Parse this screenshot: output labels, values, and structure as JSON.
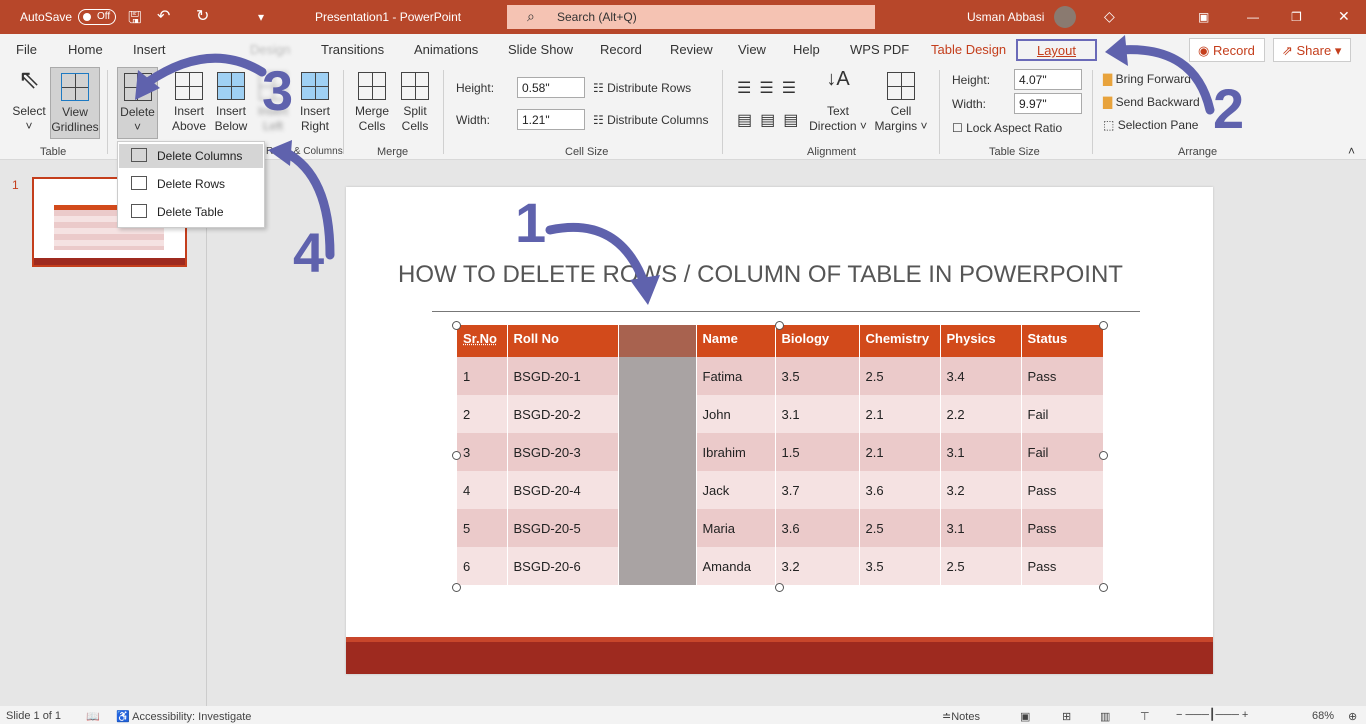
{
  "titlebar": {
    "autosave": "AutoSave",
    "autosave_state": "Off",
    "doc_title": "Presentation1  -  PowerPoint",
    "search_placeholder": "Search (Alt+Q)",
    "user": "Usman Abbasi"
  },
  "tabs": [
    "File",
    "Home",
    "Insert",
    "Design",
    "Transitions",
    "Animations",
    "Slide Show",
    "Record",
    "Review",
    "View",
    "Help",
    "WPS PDF",
    "Table Design",
    "Layout"
  ],
  "active_tab": "Layout",
  "record_btn": "Record",
  "share_btn": "Share",
  "ribbon": {
    "table_group": {
      "label": "Table",
      "select": "Select",
      "view_gridlines": "View Gridlines"
    },
    "rows_cols": {
      "delete": "Delete",
      "insert_above": "Insert Above",
      "insert_below": "Insert Below",
      "insert_left": "Insert Left",
      "insert_right": "Insert Right",
      "label": "Rows & Columns"
    },
    "merge": {
      "label": "Merge",
      "merge_cells": "Merge Cells",
      "split_cells": "Split Cells"
    },
    "cell_size": {
      "label": "Cell Size",
      "height_label": "Height:",
      "height": "0.58\"",
      "width_label": "Width:",
      "width": "1.21\"",
      "distribute_rows": "Distribute Rows",
      "distribute_columns": "Distribute Columns"
    },
    "alignment": {
      "label": "Alignment",
      "text_direction": "Text Direction",
      "cell_margins": "Cell Margins"
    },
    "table_size": {
      "label": "Table Size",
      "height_label": "Height:",
      "height": "4.07\"",
      "width_label": "Width:",
      "width": "9.97\"",
      "lock": "Lock Aspect Ratio"
    },
    "arrange": {
      "label": "Arrange",
      "bring_forward": "Bring Forward",
      "send_backward": "Send Backward",
      "selection_pane": "Selection Pane"
    }
  },
  "delete_menu": [
    "Delete Columns",
    "Delete Rows",
    "Delete Table"
  ],
  "thumb_number": "1",
  "slide": {
    "title": "HOW TO DELETE  ROWS / COLUMN OF TABLE IN POWERPOINT",
    "headers": [
      "Sr.No",
      "Roll No",
      "",
      "Name",
      "Biology",
      "Chemistry",
      "Physics",
      "Status"
    ],
    "rows": [
      [
        "1",
        "BSGD-20-1",
        "",
        "Fatima",
        "3.5",
        "2.5",
        "3.4",
        "Pass"
      ],
      [
        "2",
        "BSGD-20-2",
        "",
        "John",
        "3.1",
        "2.1",
        "2.2",
        "Fail"
      ],
      [
        "3",
        "BSGD-20-3",
        "",
        "Ibrahim",
        "1.5",
        "2.1",
        "3.1",
        "Fail"
      ],
      [
        "4",
        "BSGD-20-4",
        "",
        "Jack",
        "3.7",
        "3.6",
        "3.2",
        "Pass"
      ],
      [
        "5",
        "BSGD-20-5",
        "",
        "Maria",
        "3.6",
        "2.5",
        "3.1",
        "Pass"
      ],
      [
        "6",
        "BSGD-20-6",
        "",
        "Amanda",
        "3.2",
        "3.5",
        "2.5",
        "Pass"
      ]
    ]
  },
  "annotations": [
    "1",
    "2",
    "3",
    "4"
  ],
  "status": {
    "slide": "Slide 1 of 1",
    "accessibility": "Accessibility: Investigate",
    "notes": "Notes",
    "zoom": "68%"
  },
  "colors": {
    "accent": "#b7472a",
    "table_header": "#d24a1b",
    "arrow": "#5f62ad"
  }
}
